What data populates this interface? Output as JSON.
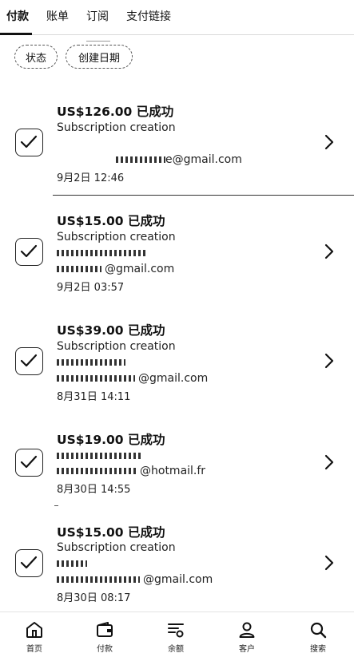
{
  "tabs": [
    {
      "label": "付款"
    },
    {
      "label": "账单"
    },
    {
      "label": "订阅"
    },
    {
      "label": "支付链接"
    }
  ],
  "filters": {
    "status": "状态",
    "created_date": "创建日期"
  },
  "payments": [
    {
      "amount": "US$126.00 已成功",
      "description": "Subscription creation",
      "email": "e@gmail.com",
      "date": "9月2日 12:46"
    },
    {
      "amount": "US$15.00 已成功",
      "description": "Subscription creation",
      "email": "@gmail.com",
      "date": "9月2日 03:57"
    },
    {
      "amount": "US$39.00 已成功",
      "description": "Subscription creation",
      "email": "@gmail.com",
      "date": "8月31日 14:11"
    },
    {
      "amount": "US$19.00 已成功",
      "description": "",
      "email": "@hotmail.fr",
      "date": "8月30日 14:55"
    },
    {
      "amount": "US$15.00 已成功",
      "description": "Subscription creation",
      "email": "@gmail.com",
      "date": "8月30日 08:17"
    }
  ],
  "bottom_nav": [
    {
      "label": "首页",
      "icon": "home-icon"
    },
    {
      "label": "付款",
      "icon": "wallet-icon"
    },
    {
      "label": "余额",
      "icon": "balance-icon"
    },
    {
      "label": "客户",
      "icon": "person-icon"
    },
    {
      "label": "搜索",
      "icon": "search-icon"
    }
  ]
}
